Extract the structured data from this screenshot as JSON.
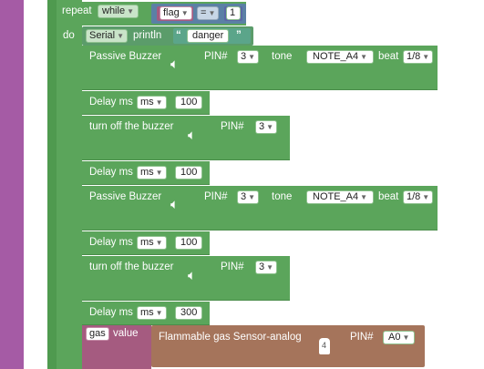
{
  "loop": {
    "repeat_label": "repeat",
    "mode": "while",
    "do_label": "do"
  },
  "condition": {
    "variable": "flag",
    "operator": "=",
    "value": "1"
  },
  "serial": {
    "object": "Serial",
    "method": "println",
    "open_quote": "“",
    "text": "danger",
    "close_quote": "”"
  },
  "blocks": [
    {
      "title": "Passive Buzzer",
      "pin_label": "PIN#",
      "pin": "3",
      "tone_label": "tone",
      "tone": "NOTE_A4",
      "beat_label": "beat",
      "beat": "1/8"
    },
    {
      "delay_label": "Delay ms",
      "unit": "ms",
      "value": "100"
    },
    {
      "title": "turn off the buzzer",
      "pin_label": "PIN#",
      "pin": "3"
    },
    {
      "delay_label": "Delay ms",
      "unit": "ms",
      "value": "100"
    },
    {
      "title": "Passive Buzzer",
      "pin_label": "PIN#",
      "pin": "3",
      "tone_label": "tone",
      "tone": "NOTE_A4",
      "beat_label": "beat",
      "beat": "1/8"
    },
    {
      "delay_label": "Delay ms",
      "unit": "ms",
      "value": "100"
    },
    {
      "title": "turn off the buzzer",
      "pin_label": "PIN#",
      "pin": "3"
    },
    {
      "delay_label": "Delay ms",
      "unit": "ms",
      "value": "300"
    }
  ],
  "gas": {
    "variable": "gas",
    "value_label": "value",
    "sensor_title": "Flammable gas Sensor-analog",
    "pin_label": "PIN#",
    "pin": "A0",
    "sensor_icon_text": "4"
  },
  "colors": {
    "loop": "#5ba55b",
    "outer": "#a55ba5",
    "serial": "#5b9c6a",
    "variable": "#a55b80",
    "sensor": "#a5745b",
    "logic": "#5b80a5"
  },
  "icons": {
    "speaker": "speaker-icon",
    "dropdown": "chevron-down-icon",
    "sensor": "gas-sensor-icon"
  }
}
